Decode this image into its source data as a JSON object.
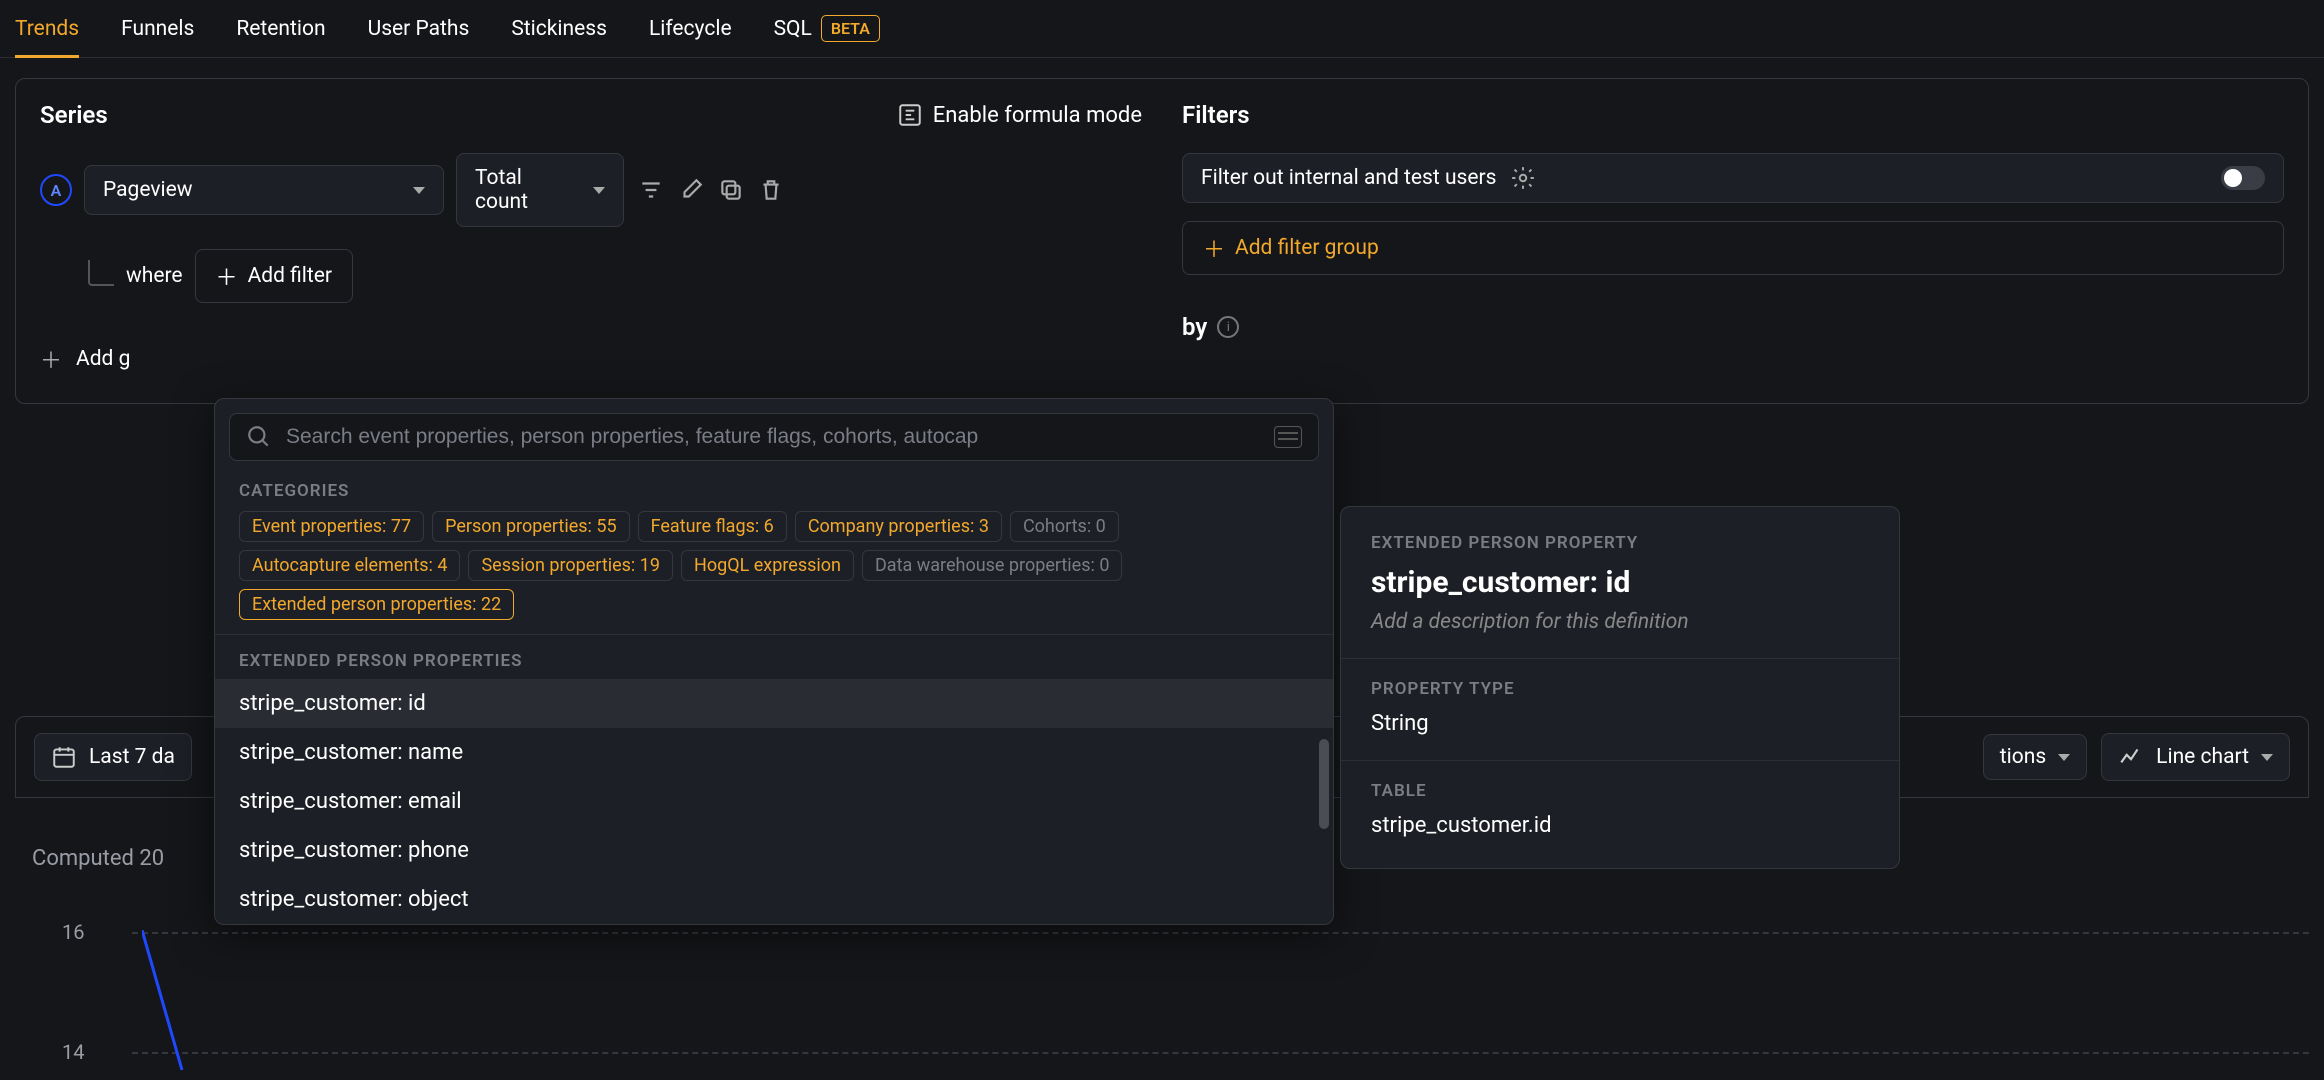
{
  "tabs": {
    "items": [
      "Trends",
      "Funnels",
      "Retention",
      "User Paths",
      "Stickiness",
      "Lifecycle",
      "SQL"
    ],
    "active_index": 0,
    "beta_label": "BETA"
  },
  "series": {
    "title": "Series",
    "formula_toggle": "Enable formula mode",
    "letter": "A",
    "event": "Pageview",
    "aggregation": "Total count",
    "where_label": "where",
    "add_filter_btn": "Add filter",
    "add_graph_btn": "Add g"
  },
  "filters": {
    "title": "Filters",
    "default_filter": "Filter out internal and test users",
    "add_filter_group_btn": "Add filter group",
    "breakdown_label": "by"
  },
  "popover": {
    "search_placeholder": "Search event properties, person properties, feature flags, cohorts, autocap",
    "categories_label": "CATEGORIES",
    "pills": [
      {
        "text": "Event properties: 77",
        "style": "normal"
      },
      {
        "text": "Person properties: 55",
        "style": "normal"
      },
      {
        "text": "Feature flags: 6",
        "style": "normal"
      },
      {
        "text": "Company properties: 3",
        "style": "normal"
      },
      {
        "text": "Cohorts: 0",
        "style": "dim"
      },
      {
        "text": "Autocapture elements: 4",
        "style": "normal"
      },
      {
        "text": "Session properties: 19",
        "style": "normal"
      },
      {
        "text": "HogQL expression",
        "style": "normal"
      },
      {
        "text": "Data warehouse properties: 0",
        "style": "dim"
      },
      {
        "text": "Extended person properties: 22",
        "style": "selected"
      }
    ],
    "section_label": "EXTENDED PERSON PROPERTIES",
    "items": [
      "stripe_customer: id",
      "stripe_customer: name",
      "stripe_customer: email",
      "stripe_customer: phone",
      "stripe_customer: object"
    ],
    "highlighted_index": 0
  },
  "detail": {
    "header_label": "EXTENDED PERSON PROPERTY",
    "title": "stripe_customer: id",
    "description_placeholder": "Add a description for this definition",
    "type_label": "PROPERTY TYPE",
    "type_value": "String",
    "table_label": "TABLE",
    "table_value": "stripe_customer.id"
  },
  "bottom": {
    "date_range": "Last 7 da",
    "computed": "Computed 20",
    "options_truncated": "tions",
    "chart_type": "Line chart"
  },
  "chart_data": {
    "type": "line",
    "y_ticks": [
      16,
      14
    ],
    "ylim": [
      12,
      18
    ]
  }
}
